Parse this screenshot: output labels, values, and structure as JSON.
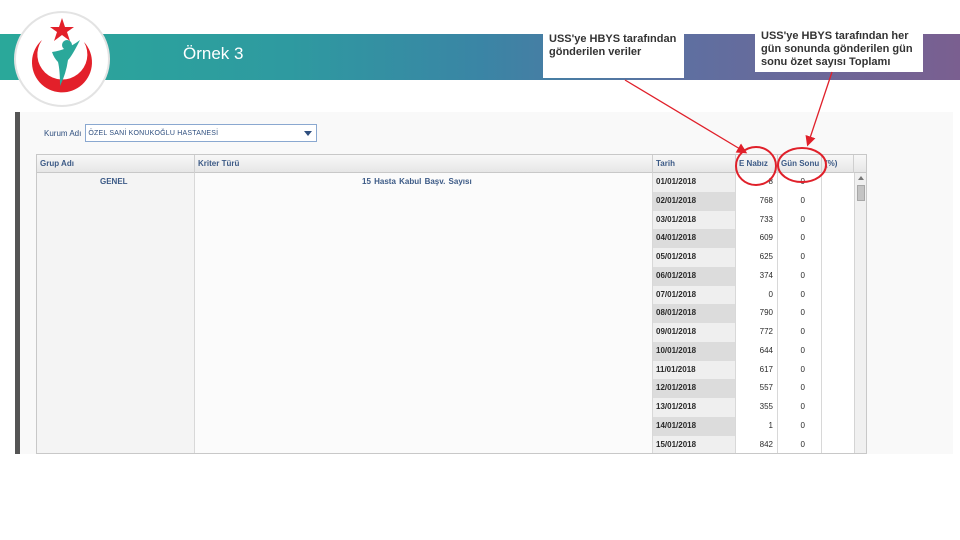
{
  "slide": {
    "title": "Örnek 3",
    "callouts": [
      "USS'ye HBYS tarafından gönderilen veriler",
      "USS'ye HBYS tarafından her gün sonunda gönderilen gün sonu özet sayısı Toplamı"
    ]
  },
  "form": {
    "kurum_label": "Kurum Adı",
    "kurum_value": "ÖZEL SANİ KONUKOĞLU HASTANESİ"
  },
  "grid": {
    "headers": {
      "grup": "Grup Adı",
      "kriter": "Kriter Türü",
      "tarih": "Tarih",
      "enabiz": "E Nabız",
      "gunsonu": "Gün Sonu",
      "yuzde": "(%)"
    },
    "grup_value": "GENEL",
    "kriter_value": "15   Hasta Kabul Başv. Sayısı",
    "rows": [
      {
        "tarih": "01/01/2018",
        "enabiz": "8",
        "gunsonu": "0"
      },
      {
        "tarih": "02/01/2018",
        "enabiz": "768",
        "gunsonu": "0"
      },
      {
        "tarih": "03/01/2018",
        "enabiz": "733",
        "gunsonu": "0"
      },
      {
        "tarih": "04/01/2018",
        "enabiz": "609",
        "gunsonu": "0"
      },
      {
        "tarih": "05/01/2018",
        "enabiz": "625",
        "gunsonu": "0"
      },
      {
        "tarih": "06/01/2018",
        "enabiz": "374",
        "gunsonu": "0"
      },
      {
        "tarih": "07/01/2018",
        "enabiz": "0",
        "gunsonu": "0"
      },
      {
        "tarih": "08/01/2018",
        "enabiz": "790",
        "gunsonu": "0"
      },
      {
        "tarih": "09/01/2018",
        "enabiz": "772",
        "gunsonu": "0"
      },
      {
        "tarih": "10/01/2018",
        "enabiz": "644",
        "gunsonu": "0"
      },
      {
        "tarih": "11/01/2018",
        "enabiz": "617",
        "gunsonu": "0"
      },
      {
        "tarih": "12/01/2018",
        "enabiz": "557",
        "gunsonu": "0"
      },
      {
        "tarih": "13/01/2018",
        "enabiz": "355",
        "gunsonu": "0"
      },
      {
        "tarih": "14/01/2018",
        "enabiz": "1",
        "gunsonu": "0"
      },
      {
        "tarih": "15/01/2018",
        "enabiz": "842",
        "gunsonu": "0"
      }
    ]
  },
  "colors": {
    "band_start": "#2aa89a",
    "band_end": "#7a5f90",
    "annotation_red": "#e0202a",
    "header_text": "#3c5a86"
  },
  "icons": {
    "logo": "ministry-crescent-star-logo",
    "dropdown": "chevron-down-icon",
    "scroll": "scroll-up-icon"
  }
}
